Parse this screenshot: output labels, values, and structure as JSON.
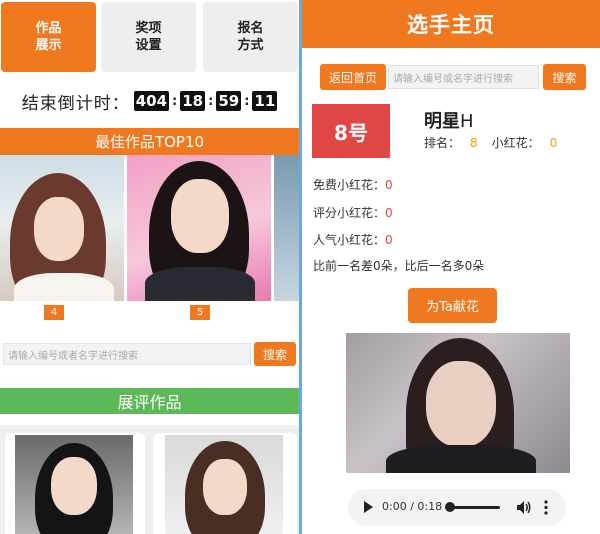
{
  "left": {
    "tabs": [
      {
        "label": "作品\n展示",
        "active": true
      },
      {
        "label": "奖项\n设置",
        "active": false
      },
      {
        "label": "报名\n方式",
        "active": false
      }
    ],
    "countdown": {
      "label": "结束倒计时：",
      "days": "404",
      "hours": "18",
      "minutes": "59",
      "seconds": "11"
    },
    "best_works_title": "最佳作品TOP10",
    "ranks": [
      "4",
      "5"
    ],
    "search": {
      "placeholder": "请输入编号或者名字进行搜索",
      "button": "搜索"
    },
    "exhibit_title": "展评作品"
  },
  "right": {
    "header_title": "选手主页",
    "back_button": "返回首页",
    "search": {
      "placeholder": "请输入编号或名字进行搜索",
      "button": "搜索"
    },
    "number": "8号",
    "name": "明星",
    "name_suffix": "H",
    "rank_label": "排名：",
    "rank_value": "8",
    "flower_label": "小红花：",
    "flower_value": "0",
    "free_flower_label": "免费小红花：",
    "free_flower_value": "0",
    "rating_flower_label": "评分小红花：",
    "rating_flower_value": "0",
    "popular_flower_label": "人气小红花：",
    "popular_flower_value": "0",
    "compare_text": "比前一名差0朵，比后一名多0朵",
    "gift_button": "为Ta献花",
    "audio_time": "0:00 / 0:18"
  },
  "colors": {
    "accent_orange": "#f0781e",
    "green_bar": "#5db857",
    "number_red": "#e04848",
    "divider_blue": "#6aa9dc"
  }
}
